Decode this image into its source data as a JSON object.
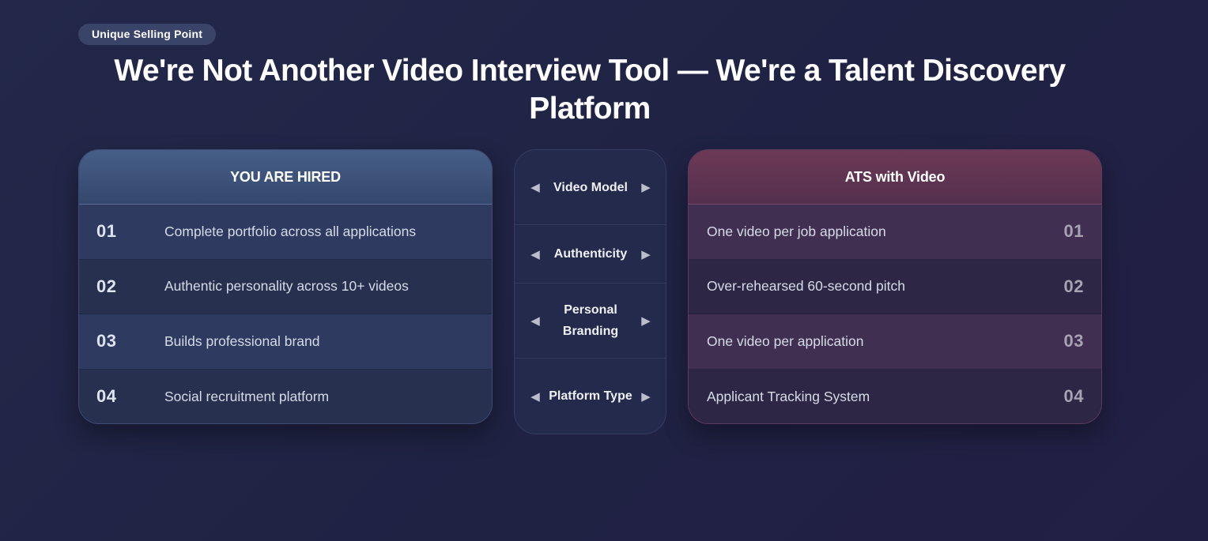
{
  "badge": "Unique Selling Point",
  "headline": "We're Not Another Video Interview Tool — We're a Talent Discovery Platform",
  "left_card": {
    "title": "YOU ARE HIRED",
    "rows": [
      {
        "num": "01",
        "text": "Complete portfolio across all applications"
      },
      {
        "num": "02",
        "text": "Authentic personality across 10+ videos"
      },
      {
        "num": "03",
        "text": "Builds professional brand"
      },
      {
        "num": "04",
        "text": "Social recruitment platform"
      }
    ]
  },
  "middle": {
    "items": [
      {
        "label": "Video Model"
      },
      {
        "label": "Authenticity"
      },
      {
        "label": "Personal Branding"
      },
      {
        "label": "Platform Type"
      }
    ],
    "left_arrow_icon": "triangle-left-icon",
    "right_arrow_icon": "triangle-right-icon",
    "left_arrow": "◀",
    "right_arrow": "▶"
  },
  "right_card": {
    "title": "ATS with Video",
    "rows": [
      {
        "num": "01",
        "text": "One video per job application"
      },
      {
        "num": "02",
        "text": "Over-rehearsed 60-second pitch"
      },
      {
        "num": "03",
        "text": "One video per application"
      },
      {
        "num": "04",
        "text": "Applicant Tracking System"
      }
    ]
  }
}
